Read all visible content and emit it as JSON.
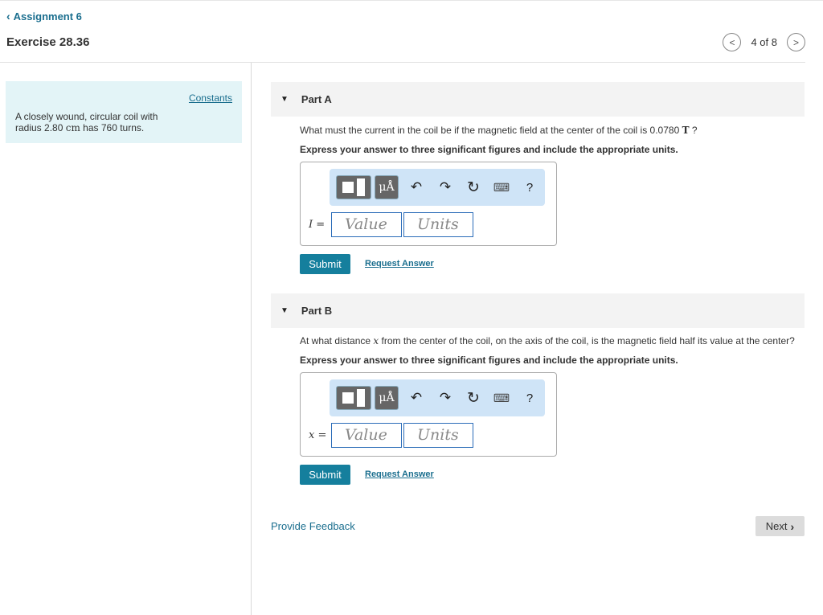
{
  "nav": {
    "back_label": "Assignment 6",
    "exercise_title": "Exercise 28.36",
    "position": "4 of 8"
  },
  "left_panel": {
    "constants_label": "Constants",
    "problem_pre": "A closely wound, circular coil with radius 2.80 ",
    "problem_unit": "cm",
    "problem_post": " has 760 turns."
  },
  "part_a": {
    "label": "Part A",
    "question_pre": "What must the current in the coil be if the magnetic field at the center of the coil is 0.0780 ",
    "question_unit": "T",
    "question_post": " ?",
    "instruction": "Express your answer to three significant figures and include the appropriate units.",
    "variable": "I",
    "equals": " =",
    "value_placeholder": "Value",
    "units_placeholder": "Units",
    "submit_label": "Submit",
    "request_label": "Request Answer"
  },
  "part_b": {
    "label": "Part B",
    "question_pre": "At what distance ",
    "question_var": "x",
    "question_post": " from the center of the coil, on the axis of the coil, is the magnetic field half its value at the center?",
    "instruction": "Express your answer to three significant figures and include the appropriate units.",
    "variable": "x",
    "equals": " =",
    "value_placeholder": "Value",
    "units_placeholder": "Units",
    "submit_label": "Submit",
    "request_label": "Request Answer"
  },
  "toolbar": {
    "units_glyph": "μÅ",
    "undo_glyph": "↶",
    "redo_glyph": "↷",
    "reset_glyph": "↻",
    "keyboard_glyph": "⌨",
    "help_glyph": "?"
  },
  "footer": {
    "feedback_label": "Provide Feedback",
    "next_label": "Next"
  },
  "colors": {
    "accent": "#157f9d",
    "link": "#1a6e8e",
    "panel_bg": "#e3f4f7",
    "toolbar_bg": "#cfe4f7"
  }
}
